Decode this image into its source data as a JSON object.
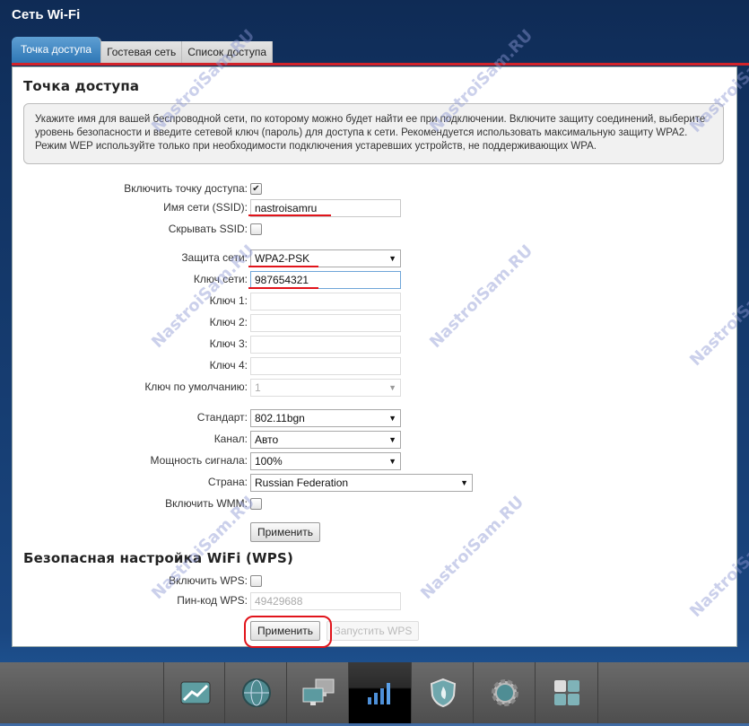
{
  "header": {
    "title": "Сеть Wi-Fi"
  },
  "tabs": [
    {
      "label": "Точка доступа",
      "active": true
    },
    {
      "label": "Гостевая сеть",
      "active": false
    },
    {
      "label": "Список доступа",
      "active": false
    }
  ],
  "access_point": {
    "title": "Точка доступа",
    "info": "Укажите имя для вашей беспроводной сети, по которому можно будет найти ее при подключении. Включите защиту соединений, выберите уровень безопасности и введите сетевой ключ (пароль) для доступа к сети. Рекомендуется использовать максимальную защиту WPA2. Режим WEP используйте только при необходимости подключения устаревших устройств, не поддерживающих WPA.",
    "enable_ap": {
      "label": "Включить точку доступа:",
      "checked": true,
      "check_glyph": "✔"
    },
    "ssid": {
      "label": "Имя сети (SSID):",
      "value": "nastroisamru"
    },
    "hide_ssid": {
      "label": "Скрывать SSID:",
      "checked": false
    },
    "security": {
      "label": "Защита сети:",
      "value": "WPA2-PSK"
    },
    "network_key": {
      "label": "Ключ сети:",
      "value": "987654321"
    },
    "key1": {
      "label": "Ключ 1:",
      "value": ""
    },
    "key2": {
      "label": "Ключ 2:",
      "value": ""
    },
    "key3": {
      "label": "Ключ 3:",
      "value": ""
    },
    "key4": {
      "label": "Ключ 4:",
      "value": ""
    },
    "default_key": {
      "label": "Ключ по умолчанию:",
      "value": "1"
    },
    "standard": {
      "label": "Стандарт:",
      "value": "802.11bgn"
    },
    "channel": {
      "label": "Канал:",
      "value": "Авто"
    },
    "power": {
      "label": "Мощность сигнала:",
      "value": "100%"
    },
    "country": {
      "label": "Страна:",
      "value": "Russian Federation"
    },
    "wmm": {
      "label": "Включить WMM:",
      "checked": false
    },
    "apply_label": "Применить"
  },
  "wps": {
    "title": "Безопасная настройка WiFi (WPS)",
    "enable": {
      "label": "Включить WPS:",
      "checked": false
    },
    "pin": {
      "label": "Пин-код WPS:",
      "value": "49429688"
    },
    "apply_label": "Применить",
    "start_label": "Запустить WPS"
  },
  "dock": [
    {
      "name": "monitor",
      "icon": "chart-icon"
    },
    {
      "name": "internet",
      "icon": "globe-icon"
    },
    {
      "name": "home-network",
      "icon": "computers-icon"
    },
    {
      "name": "wifi",
      "icon": "signal-bars-icon",
      "active": true
    },
    {
      "name": "security",
      "icon": "shield-icon"
    },
    {
      "name": "system",
      "icon": "gear-icon"
    },
    {
      "name": "apps",
      "icon": "grid-icon"
    }
  ],
  "watermark": "NastroiSam.RU",
  "arrow_glyph": "▼"
}
